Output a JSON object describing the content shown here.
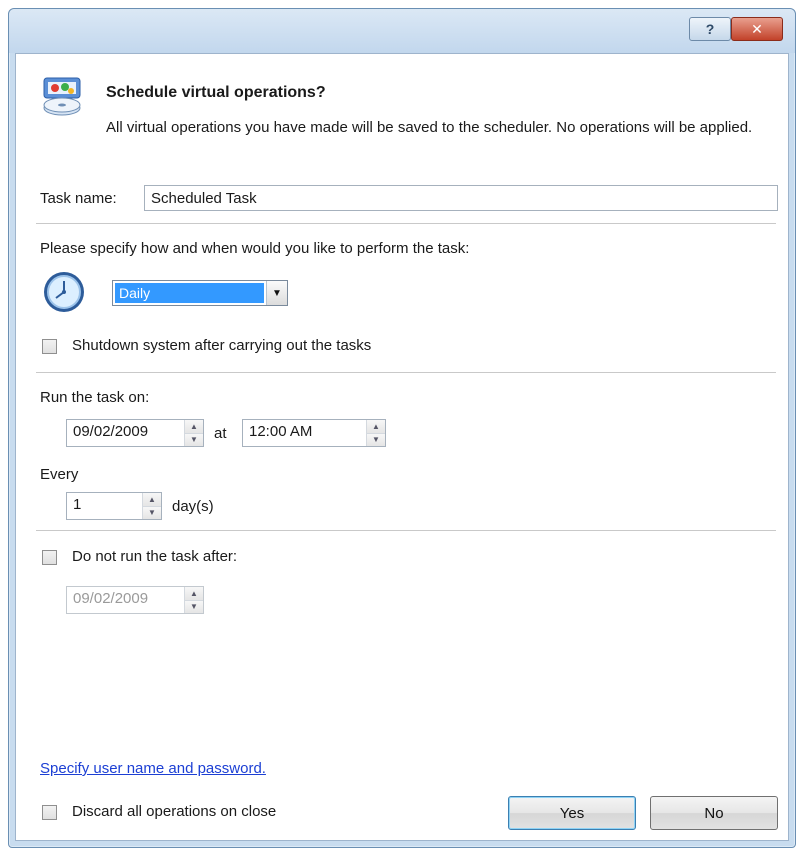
{
  "titlebar": {
    "help_label": "?",
    "close_label": "✕"
  },
  "header": {
    "title": "Schedule virtual operations?",
    "description": "All virtual operations you have made will be saved to the scheduler. No operations will be applied."
  },
  "task_name": {
    "label": "Task name:",
    "value": "Scheduled Task"
  },
  "schedule": {
    "prompt": "Please specify how and when would you like to perform the task:",
    "frequency_selected": "Daily",
    "shutdown_label": "Shutdown system after carrying out the tasks",
    "shutdown_checked": false
  },
  "run_on": {
    "label": "Run the task on:",
    "date": "09/02/2009",
    "at_label": "at",
    "time": "12:00 AM"
  },
  "every": {
    "label": "Every",
    "value": "1",
    "unit": "day(s)"
  },
  "not_after": {
    "label": "Do not run the task after:",
    "checked": false,
    "date": "09/02/2009"
  },
  "footer": {
    "credentials_link": "Specify user name and password.",
    "discard_label": "Discard all operations on close",
    "discard_checked": false,
    "yes_label": "Yes",
    "no_label": "No"
  },
  "icons": {
    "header": "schedule-disk-icon",
    "clock": "clock-icon"
  },
  "colors": {
    "accent": "#3399ff",
    "link": "#1c3fd4",
    "titlebar": "#c8dcef",
    "close_button": "#c2422a"
  }
}
